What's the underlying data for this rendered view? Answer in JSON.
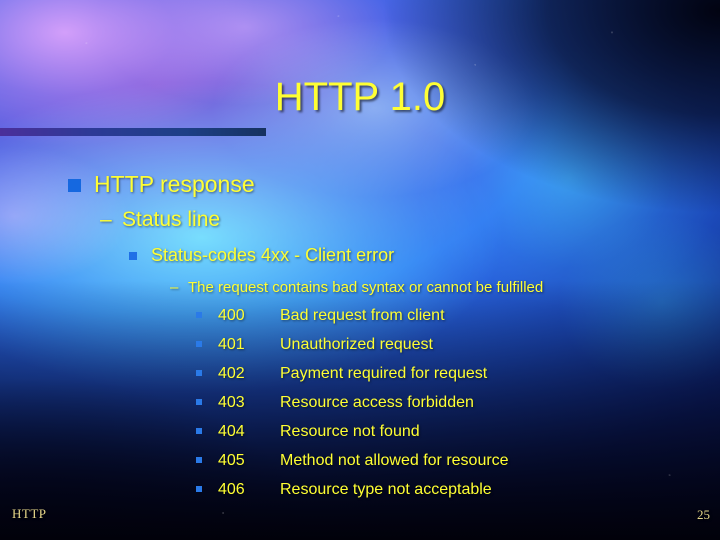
{
  "slide": {
    "title": "HTTP 1.0",
    "footer_left": "HTTP",
    "page_number": "25",
    "accent_color": "#ffff33",
    "bullet_color": "#1568e0"
  },
  "outline": {
    "level1": "HTTP response",
    "level2_dash": "–",
    "level2": "Status line",
    "level3": "Status-codes 4xx - Client error",
    "level4_dash": "–",
    "level4": "The request contains bad syntax or cannot be fulfilled"
  },
  "status_codes": [
    {
      "code": "400",
      "description": "Bad request from client"
    },
    {
      "code": "401",
      "description": "Unauthorized request"
    },
    {
      "code": "402",
      "description": "Payment required for request"
    },
    {
      "code": "403",
      "description": "Resource access forbidden"
    },
    {
      "code": "404",
      "description": "Resource not found"
    },
    {
      "code": "405",
      "description": "Method not allowed for resource"
    },
    {
      "code": "406",
      "description": "Resource type not acceptable"
    }
  ]
}
